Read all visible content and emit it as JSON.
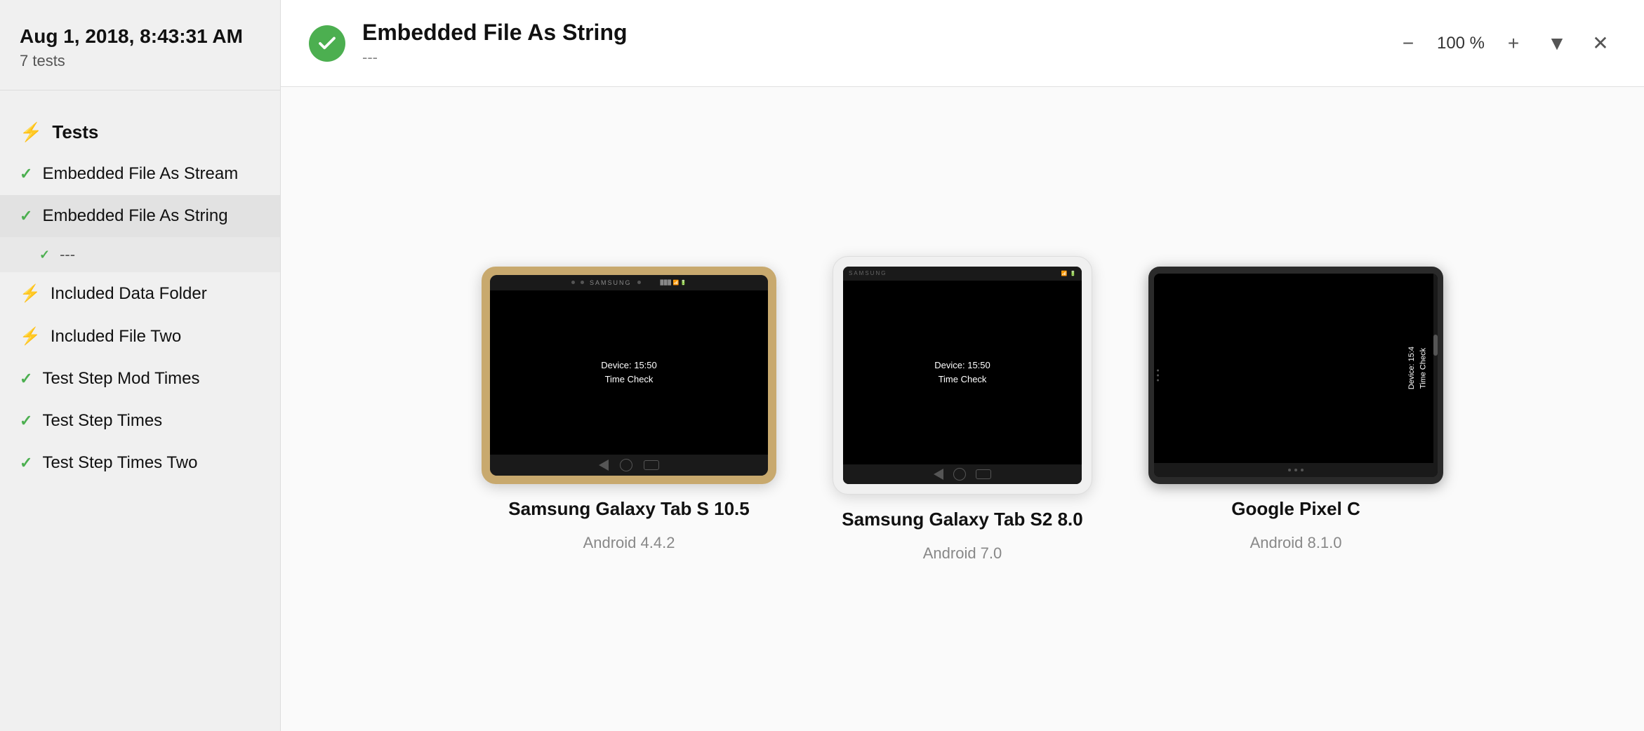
{
  "sidebar": {
    "date": "Aug 1, 2018, 8:43:31 AM",
    "count": "7 tests",
    "section_label": "Tests",
    "items": [
      {
        "id": "embedded-file-stream",
        "label": "Embedded File As Stream",
        "status": "pass"
      },
      {
        "id": "embedded-file-string",
        "label": "Embedded File As String",
        "status": "pass"
      },
      {
        "id": "embedded-file-string-sub",
        "label": "---",
        "status": "pass",
        "sub": true
      },
      {
        "id": "included-data-folder",
        "label": "Included Data Folder",
        "status": "fail"
      },
      {
        "id": "included-file-two",
        "label": "Included File Two",
        "status": "fail"
      },
      {
        "id": "test-step-mod-times",
        "label": "Test Step Mod Times",
        "status": "pass"
      },
      {
        "id": "test-step-times",
        "label": "Test Step Times",
        "status": "pass"
      },
      {
        "id": "test-step-times-two",
        "label": "Test Step Times Two",
        "status": "pass"
      }
    ]
  },
  "header": {
    "title": "Embedded File As String",
    "subtitle": "---",
    "zoom": "100 %"
  },
  "devices": [
    {
      "id": "samsung-tab-s-105",
      "name": "Samsung Galaxy Tab S 10.5",
      "os": "Android 4.4.2",
      "screen_line1": "Device: 15:50",
      "screen_line2": "Time Check"
    },
    {
      "id": "samsung-tab-s2-80",
      "name": "Samsung Galaxy Tab S2 8.0",
      "os": "Android 7.0",
      "screen_line1": "Device: 15:50",
      "screen_line2": "Time Check"
    },
    {
      "id": "google-pixel-c",
      "name": "Google Pixel C",
      "os": "Android 8.1.0",
      "screen_line1": "Device: 15:4",
      "screen_line2": "Time Check"
    }
  ],
  "controls": {
    "zoom_out": "−",
    "zoom_in": "+",
    "filter": "▼",
    "close": "✕"
  }
}
